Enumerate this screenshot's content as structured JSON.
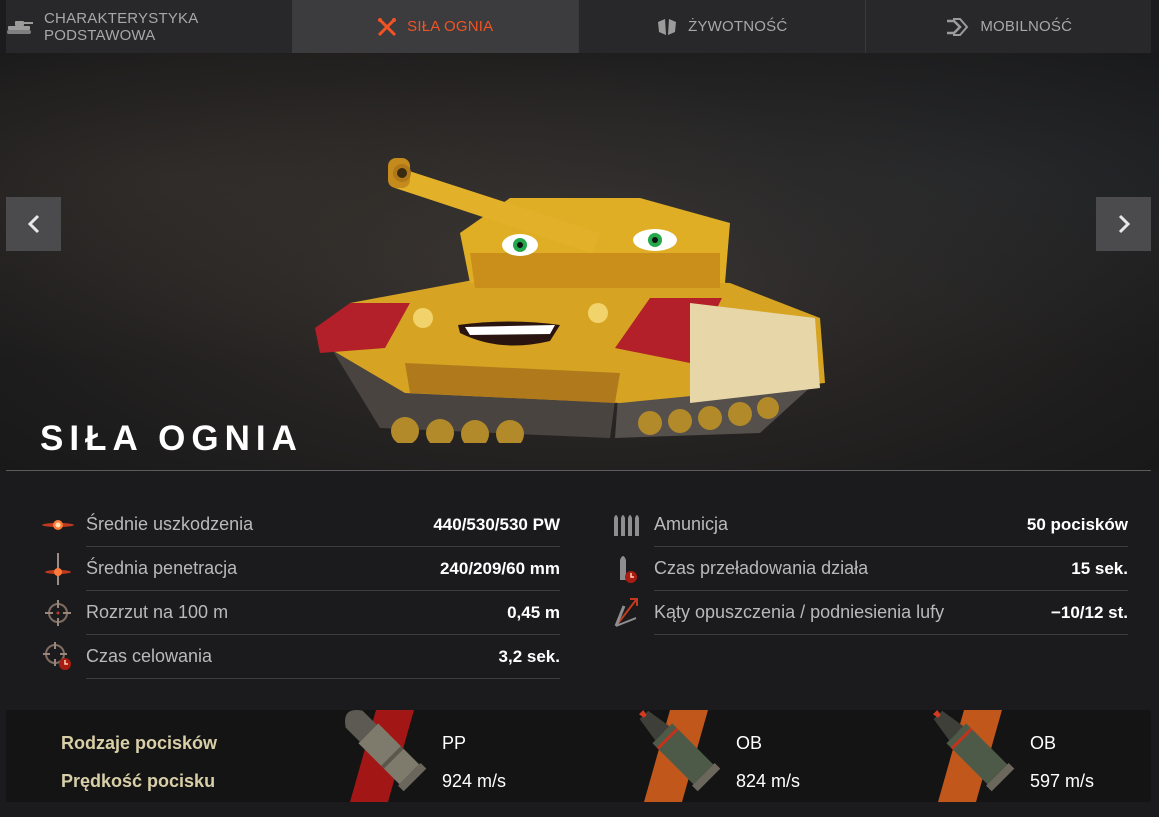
{
  "tabs": [
    {
      "label": "CHARAKTERYSTYKA PODSTAWOWA",
      "icon": "tank-icon",
      "active": false
    },
    {
      "label": "SIŁA OGNIA",
      "icon": "crossed-guns-icon",
      "active": true
    },
    {
      "label": "ŻYWOTNOŚĆ",
      "icon": "armor-plates-icon",
      "active": false
    },
    {
      "label": "MOBILNOŚĆ",
      "icon": "track-speed-icon",
      "active": false
    }
  ],
  "hero": {
    "title": "SIŁA OGNIA"
  },
  "stats": {
    "left": [
      {
        "label": "Średnie uszkodzenia",
        "value": "440/530/530 PW",
        "icon": "damage-burst-icon"
      },
      {
        "label": "Średnia penetracja",
        "value": "240/209/60 mm",
        "icon": "penetration-icon"
      },
      {
        "label": "Rozrzut na 100 m",
        "value": "0,45 m",
        "icon": "crosshair-icon"
      },
      {
        "label": "Czas celowania",
        "value": "3,2 sek.",
        "icon": "aim-time-icon"
      }
    ],
    "right": [
      {
        "label": "Amunicja",
        "value": "50 pocisków",
        "icon": "ammo-icon"
      },
      {
        "label": "Czas przeładowania działa",
        "value": "15 sek.",
        "icon": "reload-icon"
      },
      {
        "label": "Kąty opuszczenia / podniesienia lufy",
        "value": "−10/12 st.",
        "icon": "gun-angles-icon"
      }
    ]
  },
  "shells": {
    "types_label": "Rodzaje pocisków",
    "speed_label": "Prędkość pocisku",
    "items": [
      {
        "type": "PP",
        "speed": "924 m/s",
        "icon": "ap-shell-icon"
      },
      {
        "type": "OB",
        "speed": "824 m/s",
        "icon": "he-shell-icon"
      },
      {
        "type": "OB",
        "speed": "597 m/s",
        "icon": "he-shell-icon"
      }
    ]
  },
  "colors": {
    "accent": "#f25322",
    "shell_label": "#d9cfa7",
    "tank_yellow": "#d9a620",
    "tank_red": "#b3202a"
  }
}
